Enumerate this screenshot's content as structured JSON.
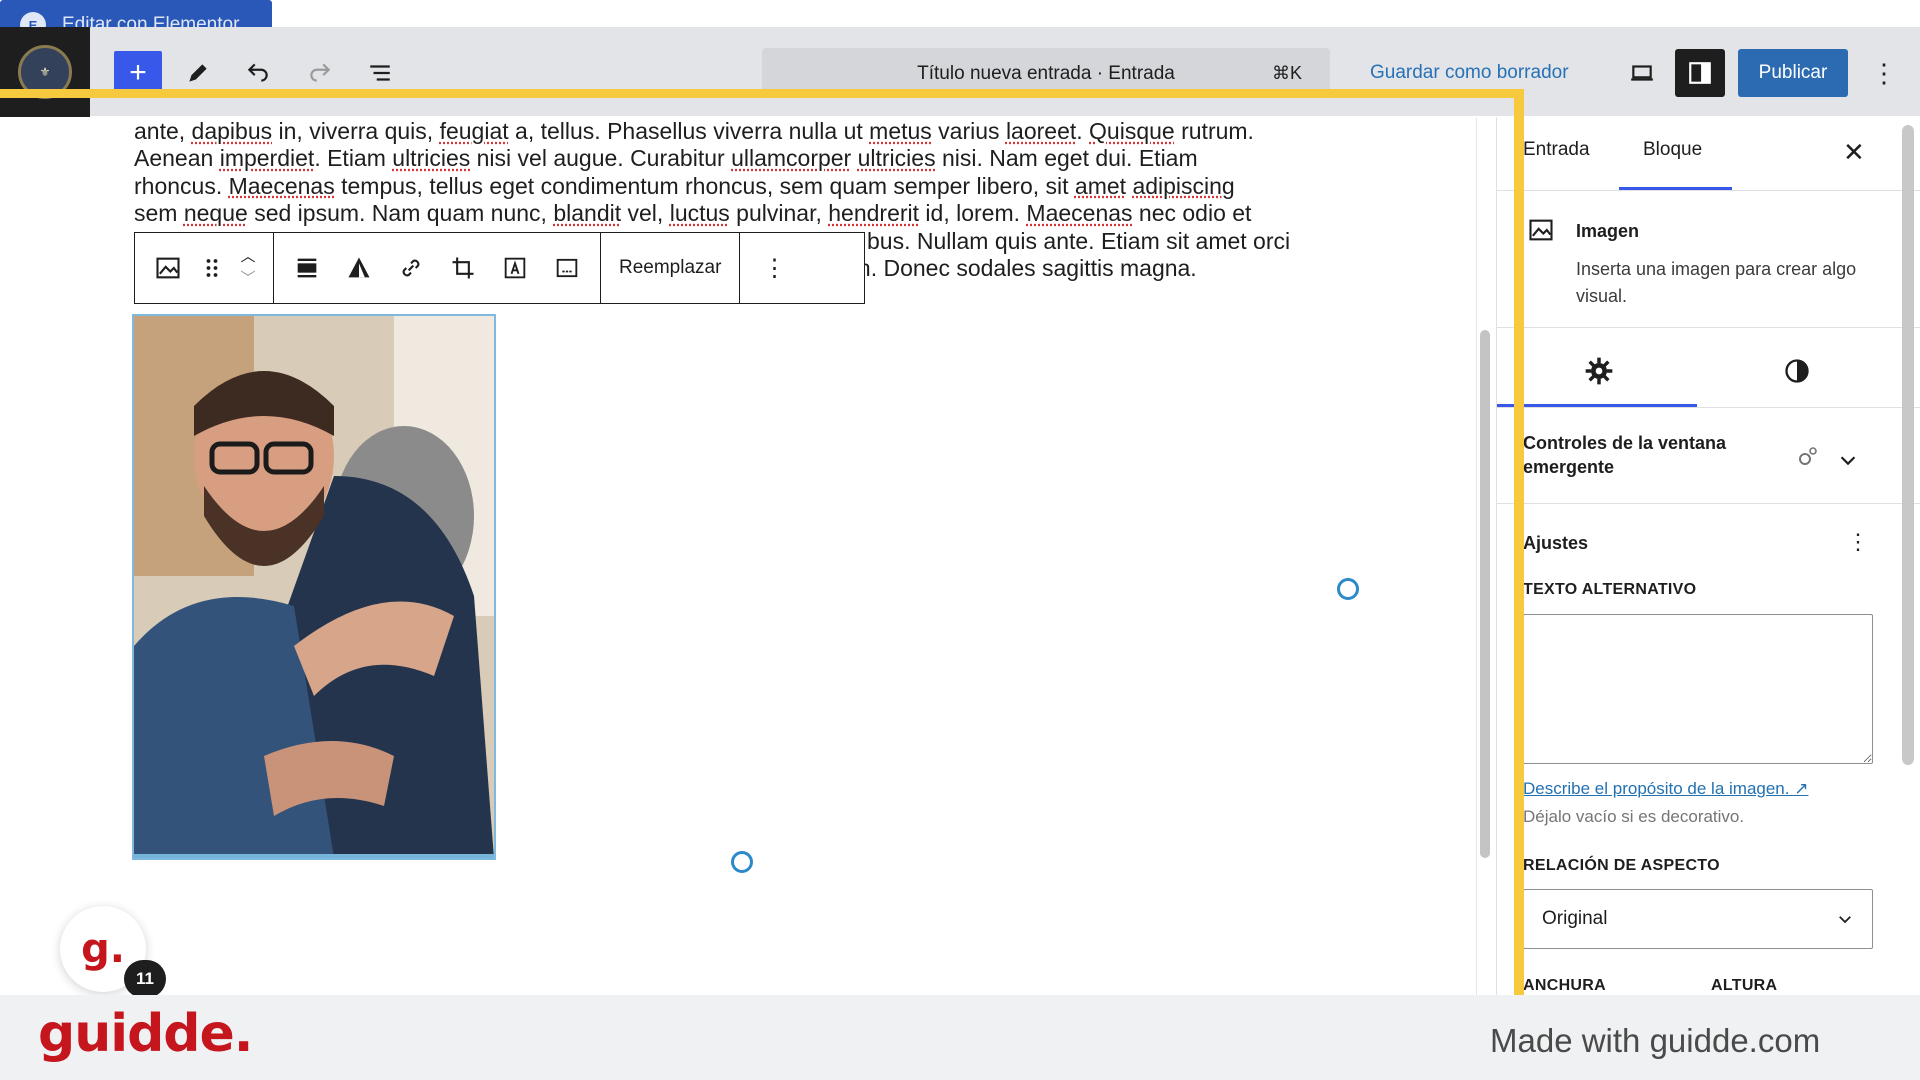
{
  "topbar": {
    "add_label": "+",
    "elementor_label": "Editar con Elementor",
    "elementor_icon_text": "E",
    "title": "Título nueva entrada · Entrada",
    "shortcut": "⌘K",
    "save_draft": "Guardar como borrador",
    "publish": "Publicar",
    "more": "⋮"
  },
  "paragraph": {
    "lines": [
      [
        "ante, ",
        {
          "sq": "dapibus"
        },
        " in, viverra quis, ",
        {
          "sq": "feugiat"
        },
        " a, tellus. Phasellus viverra nulla ut ",
        {
          "sq": "metus"
        },
        " varius ",
        {
          "sq": "laoreet"
        },
        ". ",
        {
          "sq": "Quisque"
        },
        " rutrum."
      ],
      [
        "Aenean ",
        {
          "sq": "imperdiet"
        },
        ". Etiam ",
        {
          "sq": "ultricies"
        },
        " nisi vel augue. Curabitur ",
        {
          "sq": "ullamcorper"
        },
        " ",
        {
          "sq": "ultricies"
        },
        " nisi. Nam eget dui. Etiam"
      ],
      [
        "rhoncus. ",
        {
          "sq": "Maecenas"
        },
        " tempus, tellus eget condimentum rhoncus, sem quam semper libero, sit ",
        {
          "sq": "amet"
        },
        " ",
        {
          "sq": "adipiscing"
        }
      ],
      [
        "sem ",
        {
          "sq": "neque"
        },
        " sed ipsum. Nam quam nunc, ",
        {
          "sq": "blandit"
        },
        " vel, ",
        {
          "sq": "luctus"
        },
        " pulvinar, ",
        {
          "sq": "hendrerit"
        },
        " id, lorem. ",
        {
          "sq": "Maecenas"
        },
        " nec odio et"
      ]
    ],
    "line5_visible": "bus. Nullam quis ante. Etiam sit amet orci",
    "line6_visible": "ibh. Donec sodales sagittis magna."
  },
  "block_toolbar": {
    "replace_label": "Reemplazar",
    "more": "⋮",
    "arrow_up": "︿",
    "arrow_down": "﹀"
  },
  "sidebar": {
    "tab_post": "Entrada",
    "tab_block": "Bloque",
    "close": "✕",
    "block_title": "Imagen",
    "block_desc": "Inserta una imagen para crear algo visual.",
    "popup_controls_title": "Controles de la ventana emergente",
    "settings_title": "Ajustes",
    "settings_more": "⋮",
    "alt_label": "TEXTO ALTERNATIVO",
    "alt_value": "",
    "alt_link": "Describe el propósito de la imagen. ↗",
    "alt_help": "Déjalo vacío si es decorativo.",
    "aspect_label": "RELACIÓN DE ASPECTO",
    "aspect_value": "Original",
    "width_label": "ANCHURA",
    "height_label": "ALTURA"
  },
  "guidde": {
    "bubble_letter": "g.",
    "step_count": "11",
    "brand": "guidde.",
    "made_with": "Made with guidde.com"
  },
  "colors": {
    "accent": "#3858e9",
    "publish": "#2c6bb1",
    "elementor": "#2a58b8",
    "highlight": "#f7c93e",
    "guidde_red": "#c4161c"
  },
  "icons": {
    "undo": "undo-icon",
    "redo": "redo-icon",
    "pen": "pen-icon",
    "list_view": "list-view-icon",
    "preview": "desktop-preview-icon",
    "settings_panel": "sidebar-toggle-icon"
  }
}
